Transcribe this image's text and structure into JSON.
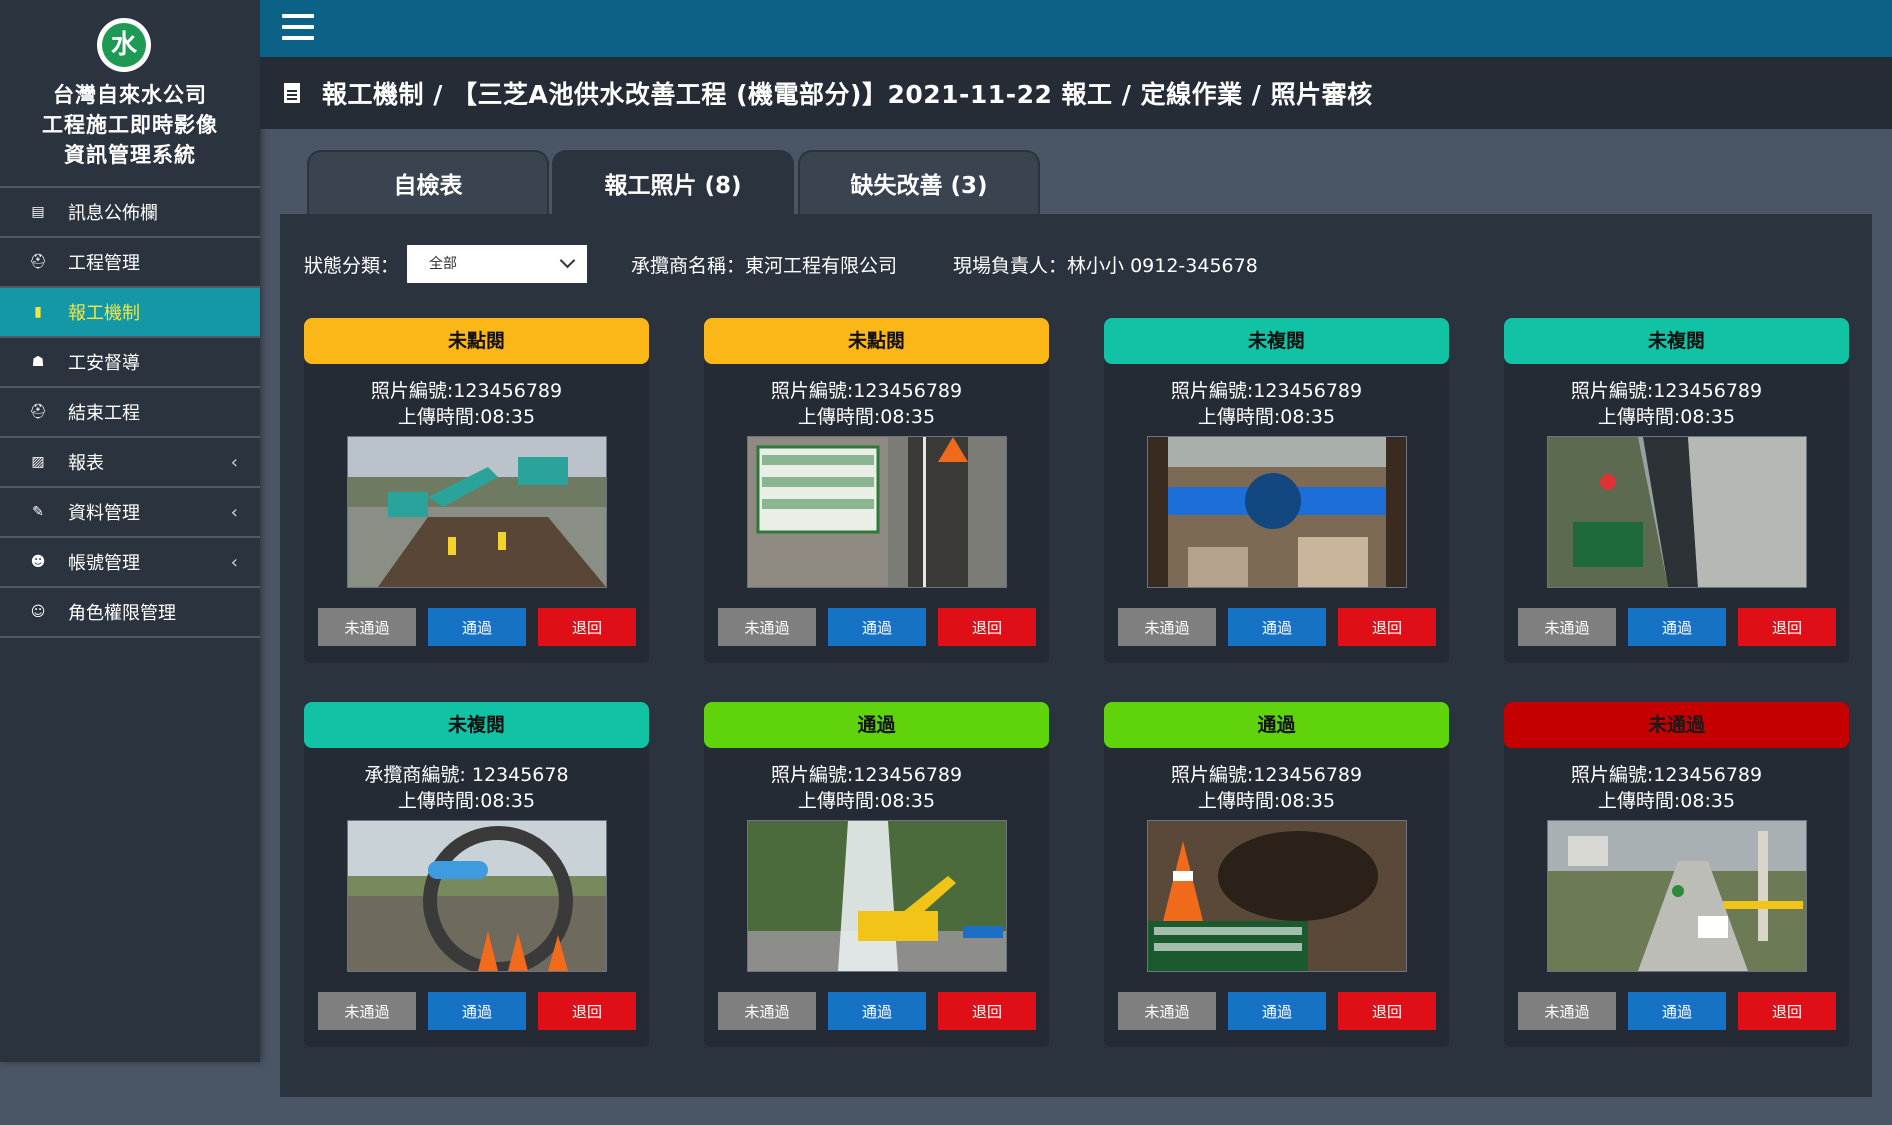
{
  "brand": {
    "logo_glyph": "水",
    "line1": "台灣自來水公司",
    "line2": "工程施工即時影像",
    "line3": "資訊管理系統"
  },
  "sidebar": {
    "items": [
      {
        "label": "訊息公佈欄",
        "icon": "message-board-icon",
        "glyph": "▤",
        "has_chevron": false
      },
      {
        "label": "工程管理",
        "icon": "hardhat-icon",
        "glyph": "⛑",
        "has_chevron": false
      },
      {
        "label": "報工機制",
        "icon": "document-icon",
        "glyph": "▮",
        "has_chevron": false,
        "active": true
      },
      {
        "label": "工安督導",
        "icon": "inspector-icon",
        "glyph": "☗",
        "has_chevron": false
      },
      {
        "label": "結束工程",
        "icon": "hardhat-icon",
        "glyph": "⛑",
        "has_chevron": false
      },
      {
        "label": "報表",
        "icon": "report-file-icon",
        "glyph": "▨",
        "has_chevron": true
      },
      {
        "label": "資料管理",
        "icon": "edit-icon",
        "glyph": "✎",
        "has_chevron": true
      },
      {
        "label": "帳號管理",
        "icon": "user-gear-icon",
        "glyph": "☻",
        "has_chevron": true
      },
      {
        "label": "角色權限管理",
        "icon": "users-icon",
        "glyph": "☺",
        "has_chevron": false
      }
    ],
    "chevron": "‹"
  },
  "header": {
    "title": "報工機制 / 【三芝A池供水改善工程 (機電部分)】2021-11-22 報工 / 定線作業 / 照片審核"
  },
  "tabs": [
    {
      "label": "自檢表"
    },
    {
      "label": "報工照片 (8)",
      "active": true
    },
    {
      "label": "缺失改善 (3)"
    }
  ],
  "filter": {
    "label": "狀態分類：",
    "selected": "全部",
    "contractor": "承攬商名稱：東河工程有限公司",
    "supervisor": "現場負責人：林小小 0912-345678"
  },
  "buttons": {
    "fail": "未通過",
    "pass": "通過",
    "return": "退回"
  },
  "colors": {
    "unclicked": "#fbb717",
    "unreviewed": "#12c2a5",
    "passed": "#5fd40c",
    "failed": "#c50000"
  },
  "cards": [
    {
      "status": "未點閱",
      "status_color": "#fbb717",
      "line1": "照片編號:123456789",
      "line2": "上傳時間:08:35",
      "photo": "construction-excavator"
    },
    {
      "status": "未點閱",
      "status_color": "#fbb717",
      "line1": "照片編號:123456789",
      "line2": "上傳時間:08:35",
      "photo": "measurement-sign"
    },
    {
      "status": "未複閱",
      "status_color": "#12c2a5",
      "line1": "照片編號:123456789",
      "line2": "上傳時間:08:35",
      "photo": "blue-pipe-valve"
    },
    {
      "status": "未複閱",
      "status_color": "#12c2a5",
      "line1": "照片編號:123456789",
      "line2": "上傳時間:08:35",
      "photo": "road-trench"
    },
    {
      "status": "未複閱",
      "status_color": "#12c2a5",
      "line1": "承攬商編號: 12345678",
      "line2": "上傳時間:08:35",
      "photo": "large-pipe"
    },
    {
      "status": "通過",
      "status_color": "#5fd40c",
      "line1": "照片編號:123456789",
      "line2": "上傳時間:08:35",
      "photo": "water-burst"
    },
    {
      "status": "通過",
      "status_color": "#5fd40c",
      "line1": "照片編號:123456789",
      "line2": "上傳時間:08:35",
      "photo": "hole-with-sign"
    },
    {
      "status": "未通過",
      "status_color": "#c50000",
      "line1": "照片編號:123456789",
      "line2": "上傳時間:08:35",
      "photo": "roadside-work"
    }
  ]
}
